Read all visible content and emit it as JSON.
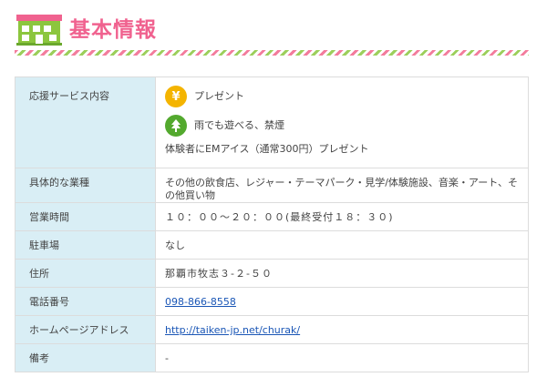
{
  "header": {
    "title": "基本情報"
  },
  "table": {
    "rows": [
      {
        "label": "応援サービス内容",
        "services": [
          {
            "icon": "yen",
            "text": "プレゼント"
          },
          {
            "icon": "tree",
            "text": "雨でも遊べる、禁煙"
          }
        ],
        "note": "体験者にEMアイス（通常300円）プレゼント"
      },
      {
        "label": "具体的な業種",
        "value": "その他の飲食店、レジャー・テーマパーク・見学/体験施設、音楽・アート、その他買い物"
      },
      {
        "label": "営業時間",
        "value": "１０：００～２０：００(最終受付１８：３０)"
      },
      {
        "label": "駐車場",
        "value": "なし"
      },
      {
        "label": "住所",
        "value": "那覇市牧志３-２-５０"
      },
      {
        "label": "電話番号",
        "value": "098-866-8558"
      },
      {
        "label": "ホームページアドレス",
        "value": "http://taiken-jp.net/churak/"
      },
      {
        "label": "備考",
        "value": "-"
      }
    ]
  },
  "colors": {
    "title": "#f0628f",
    "label_bg": "#d9eef5",
    "link": "#1a56b6",
    "yen_icon": "#f4b400",
    "tree_icon": "#53a92e"
  }
}
